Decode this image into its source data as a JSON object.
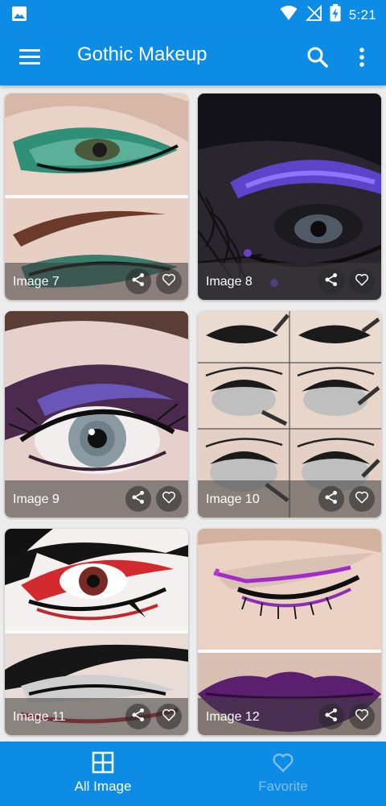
{
  "status_bar": {
    "time": "5:21",
    "icons": [
      "image-notification-icon",
      "wifi-icon",
      "no-signal-icon",
      "battery-charging-icon"
    ]
  },
  "app_bar": {
    "title": "Gothic Makeup",
    "icons": [
      "menu-icon",
      "search-icon",
      "more-vert-icon"
    ]
  },
  "gallery": {
    "items": [
      {
        "label": "Image 7"
      },
      {
        "label": "Image 8"
      },
      {
        "label": "Image 9"
      },
      {
        "label": "Image 10"
      },
      {
        "label": "Image 11"
      },
      {
        "label": "Image 12"
      }
    ],
    "item_actions": [
      "share-icon",
      "heart-icon"
    ]
  },
  "bottom_nav": {
    "items": [
      {
        "label": "All Image",
        "icon": "grid-icon",
        "active": true
      },
      {
        "label": "Favorite",
        "icon": "heart-icon",
        "active": false
      }
    ]
  },
  "colors": {
    "primary": "#0d8ce6",
    "inactive_nav": "#7fc0ef"
  }
}
